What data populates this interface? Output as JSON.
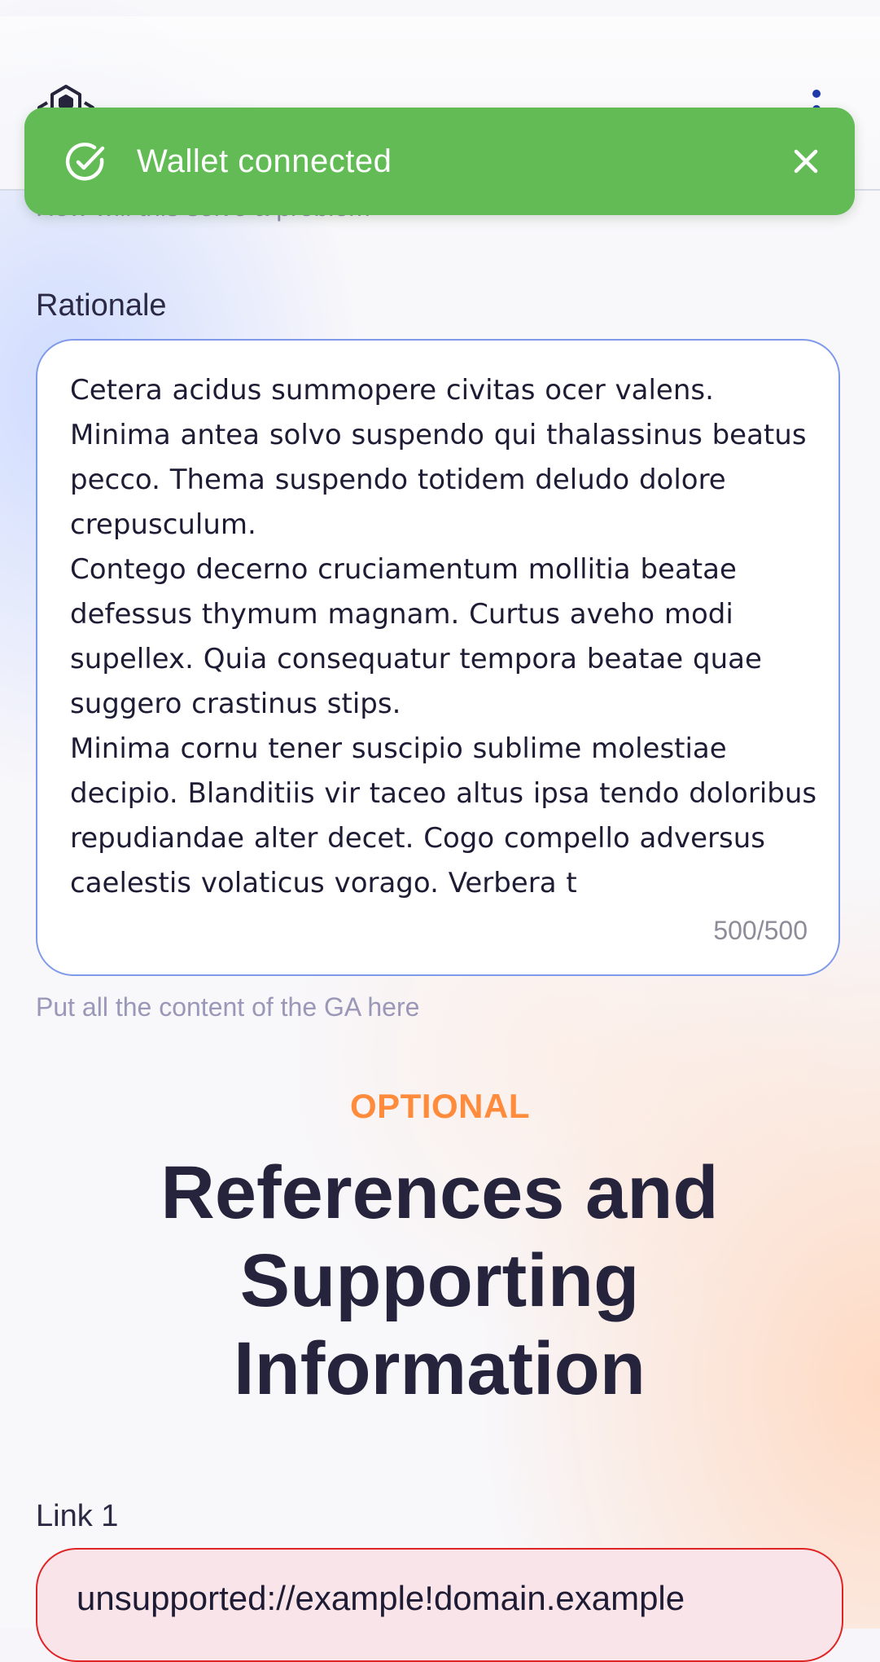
{
  "header": {
    "logo_icon": "hexagon-logo-icon",
    "menu_icon": "vertical-dots-menu-icon"
  },
  "toast": {
    "message": "Wallet connected",
    "status_icon": "check-circle-icon",
    "close_icon": "close-icon",
    "color": "#62bb55"
  },
  "form": {
    "previous_helper": "How will this solve a problem",
    "rationale": {
      "label": "Rationale",
      "value": "Cetera acidus summopere civitas ocer valens.\nMinima antea solvo suspendo qui thalassinus beatus pecco. Thema suspendo totidem deludo dolore crepusculum.\nContego decerno cruciamentum mollitia beatae defessus thymum magnam. Curtus aveho modi supellex. Quia consequatur tempora beatae quae suggero crastinus stips.\nMinima cornu tener suscipio sublime molestiae decipio. Blanditiis vir taceo altus ipsa tendo doloribus repudiandae alter decet. Cogo compello adversus caelestis volaticus vorago. Verbera t",
      "counter": "500/500",
      "helper": "Put all the content of the GA here"
    }
  },
  "references": {
    "eyebrow": "OPTIONAL",
    "title": "References and Supporting Information",
    "link1": {
      "label": "Link 1",
      "value": "unsupported://example!domain.example"
    }
  },
  "colors": {
    "accent_orange": "#ff8c3d",
    "input_border": "#7f9aea",
    "error_border": "#e02424",
    "error_fill": "#f9e5e9"
  }
}
